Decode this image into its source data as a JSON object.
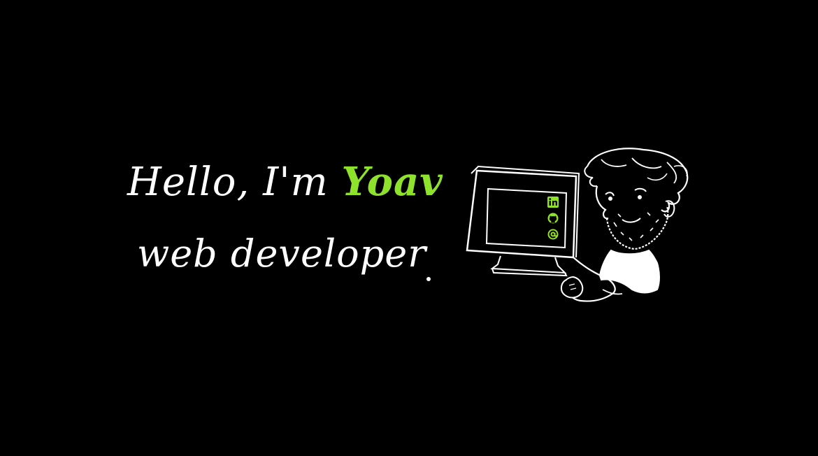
{
  "hero": {
    "greeting_prefix": "Hello, I'm ",
    "name": "Yoav",
    "role": "web developer",
    "accent_color": "#8fe22c",
    "text_color": "#ffffff",
    "background": "#000000"
  },
  "social_links": [
    {
      "icon": "linkedin-icon",
      "label": "in"
    },
    {
      "icon": "github-icon"
    },
    {
      "icon": "email-at-icon",
      "label": "@"
    }
  ]
}
